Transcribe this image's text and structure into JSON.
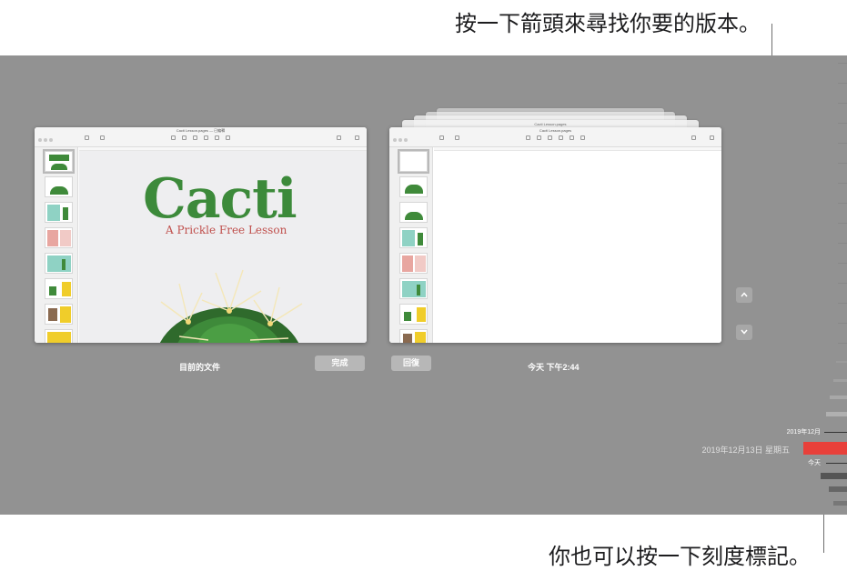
{
  "callouts": {
    "top": "按一下箭頭來尋找你要的版本。",
    "bottom": "你也可以按一下刻度標記。"
  },
  "current_doc": {
    "title": "Cacti Lesson.pages",
    "title_suffix": "— 已編輯",
    "caption": "目前的文件",
    "done_label": "完成",
    "slide_title": "Cacti",
    "slide_subtitle": "A Prickle Free Lesson"
  },
  "previous_version": {
    "title": "Cacti Lesson.pages",
    "stack_title": "Cacti Lesson.pages",
    "caption": "今天 下午2:44",
    "restore_label": "回復"
  },
  "navigation": {
    "up_icon": "chevron-up-icon",
    "down_icon": "chevron-down-icon"
  },
  "timeline": {
    "month_label": "2019年12月",
    "date_label": "2019年12月13日 星期五",
    "today_label": "今天"
  },
  "colors": {
    "stage": "#929292",
    "cacti_green": "#3c8a3a",
    "subtitle_red": "#c0504d",
    "timeline_highlight": "#e8403a"
  }
}
